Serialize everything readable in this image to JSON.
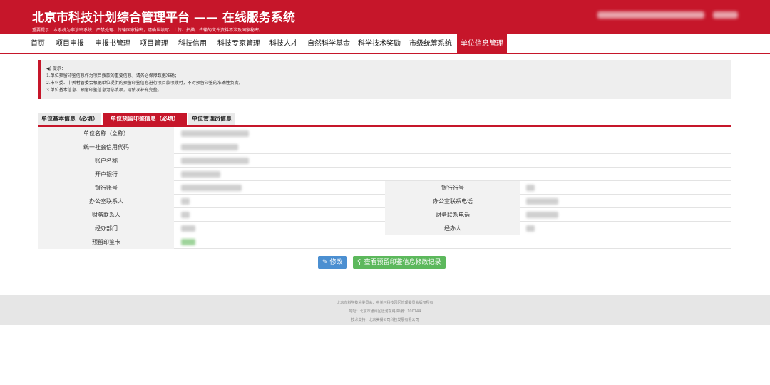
{
  "header": {
    "title": "北京市科技计划综合管理平台 —— 在线服务系统",
    "notice": "重要提示：本系统为非涉密系统，严禁处理、传输国家秘密，请确认填写、上传、扫描、传输的文件资料不涉及国家秘密。"
  },
  "nav": {
    "items": [
      "首页",
      "项目申报",
      "申报书管理",
      "项目管理",
      "科技信用",
      "科技专家管理",
      "科技人才",
      "自然科学基金",
      "科学技术奖励",
      "市级统筹系统",
      "单位信息管理"
    ],
    "active_index": 10
  },
  "tips": {
    "title": "◀) 提示：",
    "lines": [
      "1.单位预留印鉴信息作为项目拨款的重要信息，请务必保障数据准确；",
      "2.市科委、中关村管委会根据单位提供的预留印鉴信息进行项目款项拨付，不对预留印鉴的准确性负责。",
      "3.单位基本信息、预留印鉴信息为必填项，请依次补充完整。"
    ]
  },
  "tabs": [
    "单位基本信息（必填）",
    "单位预留印鉴信息（必填）",
    "单位管理员信息"
  ],
  "active_tab": 1,
  "form": {
    "unit_name_label": "单位名称（全称）",
    "credit_code_label": "统一社会信用代码",
    "account_name_label": "账户名称",
    "bank_label": "开户银行",
    "bank_account_label": "银行账号",
    "bank_number_label": "银行行号",
    "office_contact_label": "办公室联系人",
    "office_phone_label": "办公室联系电话",
    "finance_contact_label": "财务联系人",
    "finance_phone_label": "财务联系电话",
    "department_label": "经办部门",
    "handler_label": "经办人",
    "seal_card_label": "预留印鉴卡"
  },
  "buttons": {
    "edit": "修改",
    "view_log": "查看预留印鉴信息修改记录"
  },
  "footer": {
    "line1": "北京市科学技术委员会、中关村科技园区管理委员会版权所有",
    "line2": "地址：北京市通州区运河东路",
    "line2_code": "邮编：100744",
    "line3": "技术支持：北京美餐公司科技发展有限公司"
  },
  "colors": {
    "brand_red": "#c6162a",
    "edit_blue": "#4b8fd1",
    "log_green": "#5cb85c"
  }
}
